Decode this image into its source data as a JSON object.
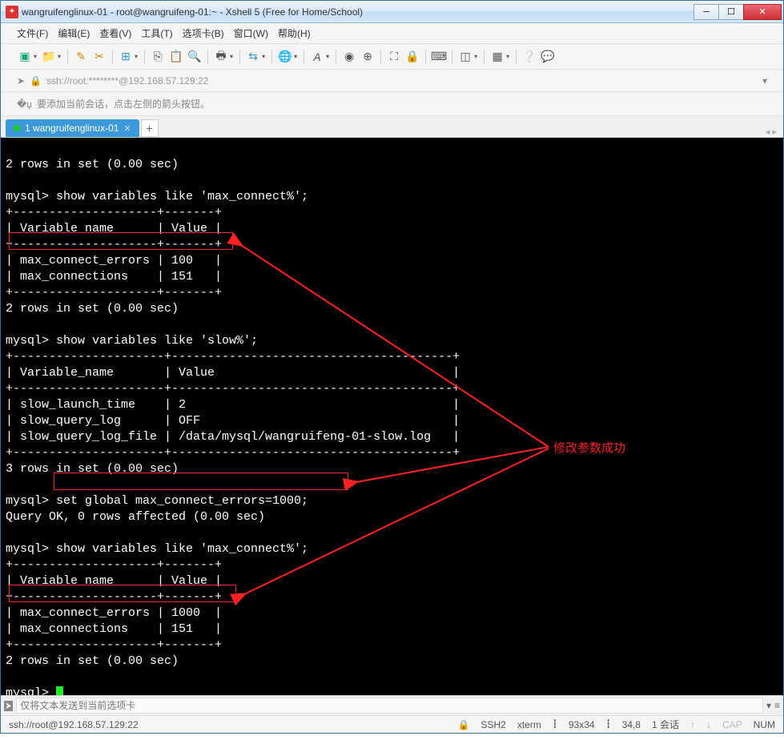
{
  "titlebar": {
    "text": "wangruifenglinux-01 - root@wangruifeng-01:~ - Xshell 5 (Free for Home/School)"
  },
  "menubar": {
    "file": "文件(F)",
    "edit": "编辑(E)",
    "view": "查看(V)",
    "tools": "工具(T)",
    "options": "选项卡(B)",
    "window": "窗口(W)",
    "help": "帮助(H)"
  },
  "addrbar": {
    "text": "ssh://root:********@192.168.57.129:22"
  },
  "hintbar": {
    "text": "要添加当前会话，点击左侧的箭头按钮。"
  },
  "tab": {
    "label": "1 wangruifenglinux-01"
  },
  "annotation": {
    "label": "修改参数成功"
  },
  "sendbar": {
    "placeholder": "仅将文本发送到当前选项卡"
  },
  "statusbar": {
    "conn": "ssh://root@192.168.57.129:22",
    "proto": "SSH2",
    "term": "xterm",
    "size": "93x34",
    "pos": "34,8",
    "sess": "1 会话",
    "cap": "CAP",
    "num": "NUM"
  },
  "terminal": {
    "l0": "2 rows in set (0.00 sec)",
    "l1": "",
    "l2": "mysql> show variables like 'max_connect%';",
    "l3": "+--------------------+-------+",
    "l4": "| Variable_name      | Value |",
    "l5": "+--------------------+-------+",
    "l6": "| max_connect_errors | 100   |",
    "l7": "| max_connections    | 151   |",
    "l8": "+--------------------+-------+",
    "l9": "2 rows in set (0.00 sec)",
    "l10": "",
    "l11": "mysql> show variables like 'slow%';",
    "l12": "+---------------------+---------------------------------------+",
    "l13": "| Variable_name       | Value                                 |",
    "l14": "+---------------------+---------------------------------------+",
    "l15": "| slow_launch_time    | 2                                     |",
    "l16": "| slow_query_log      | OFF                                   |",
    "l17": "| slow_query_log_file | /data/mysql/wangruifeng-01-slow.log   |",
    "l18": "+---------------------+---------------------------------------+",
    "l19": "3 rows in set (0.00 sec)",
    "l20": "",
    "l21": "mysql> set global max_connect_errors=1000;",
    "l22": "Query OK, 0 rows affected (0.00 sec)",
    "l23": "",
    "l24": "mysql> show variables like 'max_connect%';",
    "l25": "+--------------------+-------+",
    "l26": "| Variable_name      | Value |",
    "l27": "+--------------------+-------+",
    "l28": "| max_connect_errors | 1000  |",
    "l29": "| max_connections    | 151   |",
    "l30": "+--------------------+-------+",
    "l31": "2 rows in set (0.00 sec)",
    "l32": "",
    "l33": "mysql> "
  }
}
